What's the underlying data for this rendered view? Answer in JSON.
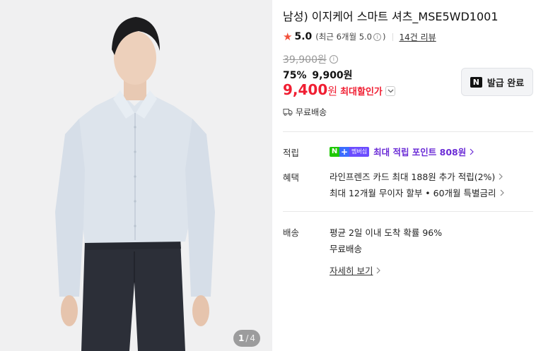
{
  "image": {
    "counter_current": "1",
    "counter_separator": "/",
    "counter_total": "4"
  },
  "product": {
    "title": "남성) 이지케어 스마트 셔츠_MSE5WD1001",
    "rating": "5.0",
    "recent_rating": "(최근 6개월 5.0",
    "recent_close": ")",
    "review_count": "14건 리뷰",
    "original_price": "39,900원",
    "discount_rate": "75%",
    "sale_price": "9,900원",
    "max_discount_price": "9,400",
    "max_discount_won": "원",
    "max_discount_label": "최대할인가",
    "coupon_button": "발급 완료",
    "coupon_logo": "N",
    "shipping_tag": "무료배송"
  },
  "benefits": {
    "points_label": "적립",
    "membership_badge_n": "N",
    "membership_badge_plus": "+",
    "membership_badge_text": "멤버십",
    "points_text": "최대 적립 포인트 808원",
    "perks_label": "혜택",
    "perk_1": "라인프렌즈 카드 최대 188원 추가 적립(2%)",
    "perk_2": "최대 12개월 무이자 할부 • 60개월 특별금리"
  },
  "delivery": {
    "label": "배송",
    "line_1": "평균 2일 이내 도착 확률 96%",
    "line_2": "무료배송",
    "detail_link": "자세히 보기"
  },
  "colors": {
    "accent_red": "#f01e32",
    "star": "#f2503a",
    "membership_purple": "#6b2cd6",
    "naver_green": "#1ec800"
  }
}
